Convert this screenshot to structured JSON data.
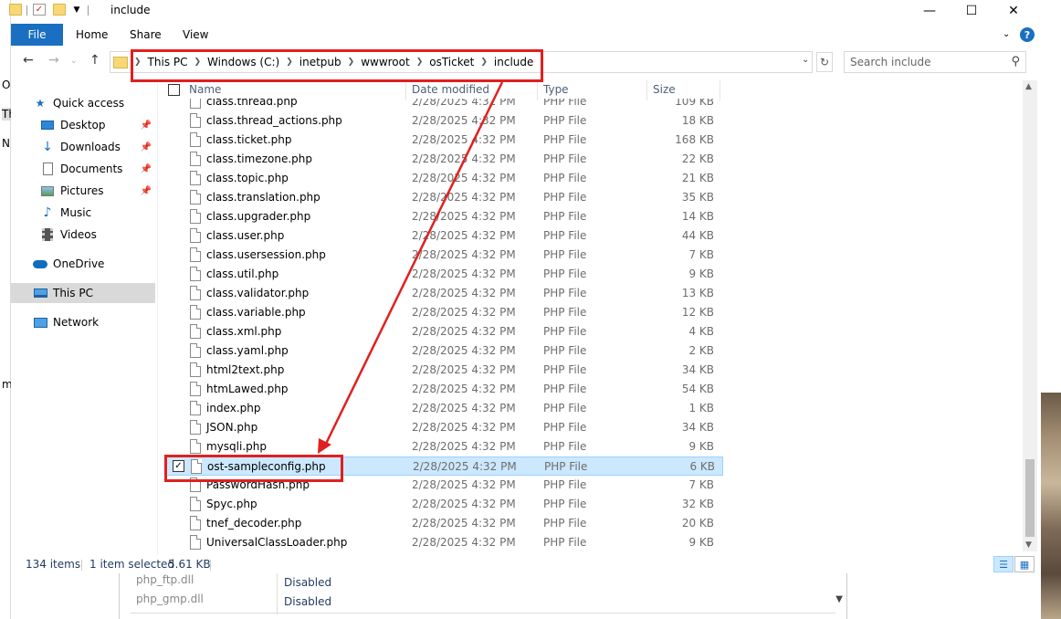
{
  "background": {
    "left_letters": [
      "O",
      "Th",
      "N",
      "m:"
    ],
    "disabled_rows": [
      {
        "name": "php_ftp.dll",
        "status": "Disabled"
      },
      {
        "name": "php_gmp.dll",
        "status": "Disabled"
      }
    ]
  },
  "window": {
    "title": "include",
    "minimize_icon": "minimize-icon",
    "maximize_icon": "maximize-icon",
    "close_icon": "close-icon"
  },
  "ribbon": {
    "file": "File",
    "home": "Home",
    "share": "Share",
    "view": "View",
    "expand_icon": "chevron-down-icon",
    "help": "?"
  },
  "address": {
    "crumbs": [
      "This PC",
      "Windows (C:)",
      "inetpub",
      "wwwroot",
      "osTicket",
      "include"
    ],
    "search_placeholder": "Search include"
  },
  "nav": {
    "quick_access": "Quick access",
    "desktop": "Desktop",
    "downloads": "Downloads",
    "documents": "Documents",
    "pictures": "Pictures",
    "music": "Music",
    "videos": "Videos",
    "onedrive": "OneDrive",
    "this_pc": "This PC",
    "network": "Network"
  },
  "columns": {
    "name": "Name",
    "date": "Date modified",
    "type": "Type",
    "size": "Size"
  },
  "files": [
    {
      "name": "class.thread.php",
      "date": "2/28/2025 4:32 PM",
      "type": "PHP File",
      "size": "109 KB"
    },
    {
      "name": "class.thread_actions.php",
      "date": "2/28/2025 4:32 PM",
      "type": "PHP File",
      "size": "18 KB"
    },
    {
      "name": "class.ticket.php",
      "date": "2/28/2025 4:32 PM",
      "type": "PHP File",
      "size": "168 KB"
    },
    {
      "name": "class.timezone.php",
      "date": "2/28/2025 4:32 PM",
      "type": "PHP File",
      "size": "22 KB"
    },
    {
      "name": "class.topic.php",
      "date": "2/28/2025 4:32 PM",
      "type": "PHP File",
      "size": "21 KB"
    },
    {
      "name": "class.translation.php",
      "date": "2/28/2025 4:32 PM",
      "type": "PHP File",
      "size": "35 KB"
    },
    {
      "name": "class.upgrader.php",
      "date": "2/28/2025 4:32 PM",
      "type": "PHP File",
      "size": "14 KB"
    },
    {
      "name": "class.user.php",
      "date": "2/28/2025 4:32 PM",
      "type": "PHP File",
      "size": "44 KB"
    },
    {
      "name": "class.usersession.php",
      "date": "2/28/2025 4:32 PM",
      "type": "PHP File",
      "size": "7 KB"
    },
    {
      "name": "class.util.php",
      "date": "2/28/2025 4:32 PM",
      "type": "PHP File",
      "size": "9 KB"
    },
    {
      "name": "class.validator.php",
      "date": "2/28/2025 4:32 PM",
      "type": "PHP File",
      "size": "13 KB"
    },
    {
      "name": "class.variable.php",
      "date": "2/28/2025 4:32 PM",
      "type": "PHP File",
      "size": "12 KB"
    },
    {
      "name": "class.xml.php",
      "date": "2/28/2025 4:32 PM",
      "type": "PHP File",
      "size": "4 KB"
    },
    {
      "name": "class.yaml.php",
      "date": "2/28/2025 4:32 PM",
      "type": "PHP File",
      "size": "2 KB"
    },
    {
      "name": "html2text.php",
      "date": "2/28/2025 4:32 PM",
      "type": "PHP File",
      "size": "34 KB"
    },
    {
      "name": "htmLawed.php",
      "date": "2/28/2025 4:32 PM",
      "type": "PHP File",
      "size": "54 KB"
    },
    {
      "name": "index.php",
      "date": "2/28/2025 4:32 PM",
      "type": "PHP File",
      "size": "1 KB"
    },
    {
      "name": "JSON.php",
      "date": "2/28/2025 4:32 PM",
      "type": "PHP File",
      "size": "34 KB"
    },
    {
      "name": "mysqli.php",
      "date": "2/28/2025 4:32 PM",
      "type": "PHP File",
      "size": "9 KB"
    },
    {
      "name": "ost-sampleconfig.php",
      "date": "2/28/2025 4:32 PM",
      "type": "PHP File",
      "size": "6 KB",
      "selected": true
    },
    {
      "name": "PasswordHash.php",
      "date": "2/28/2025 4:32 PM",
      "type": "PHP File",
      "size": "7 KB"
    },
    {
      "name": "Spyc.php",
      "date": "2/28/2025 4:32 PM",
      "type": "PHP File",
      "size": "32 KB"
    },
    {
      "name": "tnef_decoder.php",
      "date": "2/28/2025 4:32 PM",
      "type": "PHP File",
      "size": "20 KB"
    },
    {
      "name": "UniversalClassLoader.php",
      "date": "2/28/2025 4:32 PM",
      "type": "PHP File",
      "size": "9 KB"
    }
  ],
  "status": {
    "count": "134 items",
    "selected": "1 item selected",
    "selected_size": "5.61 KB"
  },
  "colors": {
    "accent": "#1a6fc1",
    "selection": "#cce8ff",
    "annotation_red": "#e02020"
  }
}
